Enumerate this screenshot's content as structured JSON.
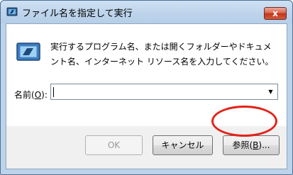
{
  "window": {
    "title": "ファイル名を指定して実行",
    "close_label": "x",
    "icon": "run-icon"
  },
  "dialog": {
    "message": "実行するプログラム名、または開くフォルダーやドキュメント名、インターネット リソース名を入力してください。",
    "field_label_prefix": "名前(",
    "field_label_key": "O",
    "field_label_suffix": "):",
    "field_value": "",
    "dropdown_icon": "chevron-down-icon"
  },
  "buttons": {
    "ok_label": "OK",
    "ok_enabled": false,
    "cancel_label": "キャンセル",
    "browse_label_prefix": "参照(",
    "browse_label_key": "B",
    "browse_label_suffix": ")..."
  },
  "annotation": {
    "highlight_color": "#e2231a",
    "target": "browse-button"
  }
}
